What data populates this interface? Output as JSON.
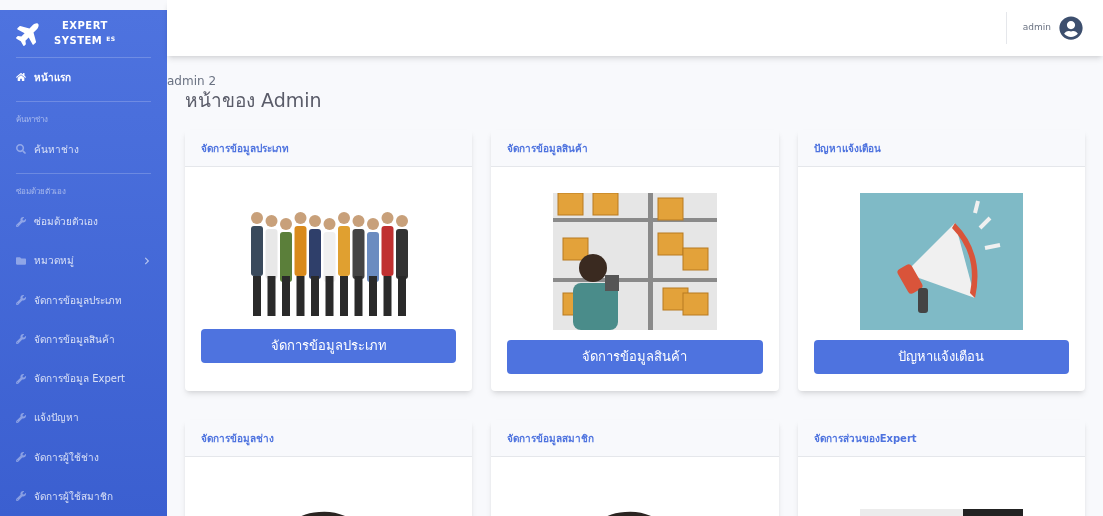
{
  "brand": {
    "line1": "EXPERT",
    "line2": "SYSTEM",
    "sup": "ES"
  },
  "sidebar": {
    "items": [
      {
        "kind": "home",
        "label": "หน้าแรก",
        "active": true
      },
      {
        "kind": "divider"
      },
      {
        "kind": "heading",
        "label": "ค้นหาช่าง"
      },
      {
        "kind": "search",
        "label": "ค้นหาช่าง",
        "active": false
      },
      {
        "kind": "divider"
      },
      {
        "kind": "heading",
        "label": "ซ่อมด้วยตัวเอง"
      },
      {
        "kind": "tool",
        "label": "ซ่อมด้วยตัวเอง",
        "active": false
      },
      {
        "kind": "folder",
        "label": "หมวดหมู่",
        "active": false,
        "expandable": true
      },
      {
        "kind": "tool",
        "label": "จัดการข้อมูลประเภท",
        "active": false
      },
      {
        "kind": "tool",
        "label": "จัดการข้อมูลสินค้า",
        "active": false
      },
      {
        "kind": "tool",
        "label": "จัดการข้อมูล Expert",
        "active": false
      },
      {
        "kind": "tool",
        "label": "แจ้งปัญหา",
        "active": false
      },
      {
        "kind": "tool",
        "label": "จัดการผู้ใช้ช่าง",
        "active": false
      },
      {
        "kind": "tool",
        "label": "จัดการผู้ใช้สมาชิก",
        "active": false
      }
    ]
  },
  "topbar": {
    "user": "admin"
  },
  "breadcrumb": "admin 2",
  "page_title": "หน้าของ Admin",
  "cards": [
    {
      "title": "จัดการข้อมูลประเภท",
      "button": "จัดการข้อมูลประเภท"
    },
    {
      "title": "จัดการข้อมูลสินค้า",
      "button": "จัดการข้อมูลสินค้า"
    },
    {
      "title": "ปัญหาแจ้งเตือน",
      "button": "ปัญหาแจ้งเตือน"
    },
    {
      "title": "จัดการข้อมูลช่าง"
    },
    {
      "title": "จัดการข้อมูลสมาชิก"
    },
    {
      "title": "จัดการส่วนของExpert"
    }
  ]
}
